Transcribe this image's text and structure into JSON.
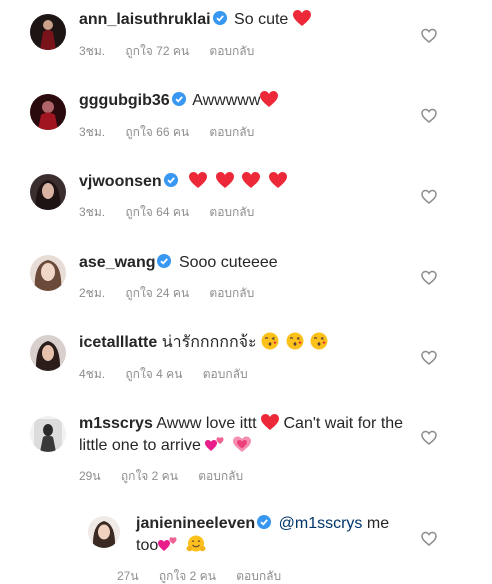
{
  "comments": [
    {
      "username": "ann_laisuthruklai",
      "text": "So cute",
      "emoji": [
        "red-heart"
      ],
      "time": "3ชม.",
      "likes": "ถูกใจ 72 คน",
      "reply": "ตอบกลับ"
    },
    {
      "username": "gggubgib36",
      "text": "Awwwww",
      "emoji": [
        "red-heart"
      ],
      "time": "3ชม.",
      "likes": "ถูกใจ 66 คน",
      "reply": "ตอบกลับ"
    },
    {
      "username": "vjwoonsen",
      "text": "",
      "emoji": [
        "red-heart",
        "red-heart",
        "red-heart",
        "red-heart"
      ],
      "time": "3ชม.",
      "likes": "ถูกใจ 64 คน",
      "reply": "ตอบกลับ"
    },
    {
      "username": "ase_wang",
      "text": "Sooo cuteeee",
      "emoji": [],
      "time": "2ชม.",
      "likes": "ถูกใจ 24 คน",
      "reply": "ตอบกลับ"
    },
    {
      "username": "icetalllatte",
      "text": "น่ารักกกกกจ้ะ",
      "emoji": [
        "kiss-face",
        "kiss-face",
        "kiss-face"
      ],
      "time": "4ชม.",
      "likes": "ถูกใจ 4 คน",
      "reply": "ตอบกลับ"
    },
    {
      "username": "m1sscrys",
      "text": "Awww love ittt",
      "text2": "Can't wait for the little one to arrive",
      "emoji": [
        "red-heart"
      ],
      "emoji2": [
        "two-hearts",
        "growing-heart"
      ],
      "time": "29น",
      "likes": "ถูกใจ 2 คน",
      "reply": "ตอบกลับ"
    },
    {
      "username": "janienineeleven",
      "mention": "@m1sscrys",
      "text": "me too",
      "emoji": [
        "two-hearts",
        "hugging-face"
      ],
      "time": "27น",
      "likes": "ถูกใจ 2 คน",
      "reply": "ตอบกลับ"
    }
  ],
  "colors": {
    "verified": "#3897f0",
    "meta": "#8e8e8e",
    "mention": "#003569",
    "heart": "#ed2939"
  }
}
